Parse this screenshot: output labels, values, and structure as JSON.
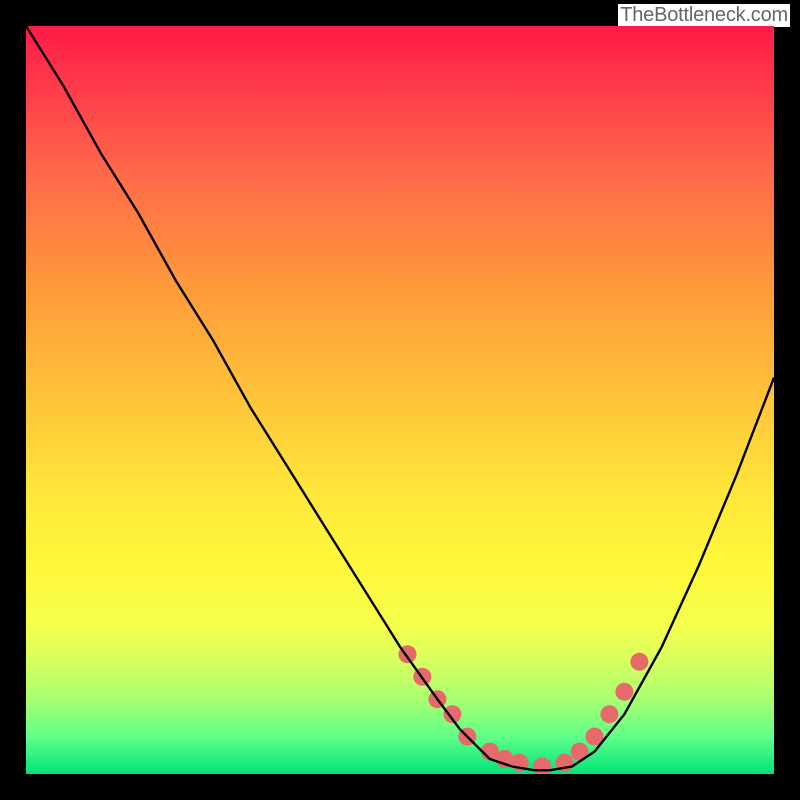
{
  "attribution": "TheBottleneck.com",
  "chart_data": {
    "type": "line",
    "title": "",
    "xlabel": "",
    "ylabel": "",
    "xlim": [
      0,
      100
    ],
    "ylim": [
      0,
      100
    ],
    "series": [
      {
        "name": "bottleneck-curve",
        "x": [
          0,
          5,
          10,
          15,
          20,
          25,
          30,
          35,
          40,
          45,
          50,
          55,
          58,
          60,
          62,
          65,
          68,
          70,
          73,
          76,
          80,
          85,
          90,
          95,
          100
        ],
        "y": [
          100,
          92,
          83,
          75,
          66,
          58,
          49,
          41,
          33,
          25,
          17,
          10,
          6,
          4,
          2,
          1,
          0.5,
          0.5,
          1,
          3,
          8,
          17,
          28,
          40,
          53
        ]
      }
    ],
    "markers": {
      "name": "highlight-points",
      "x": [
        51,
        53,
        55,
        57,
        59,
        62,
        64,
        66,
        69,
        72,
        74,
        76,
        78,
        80,
        82
      ],
      "y": [
        16,
        13,
        10,
        8,
        5,
        3,
        2,
        1.5,
        1,
        1.5,
        3,
        5,
        8,
        11,
        15
      ],
      "color": "#e76a6a",
      "radius": 9
    }
  }
}
